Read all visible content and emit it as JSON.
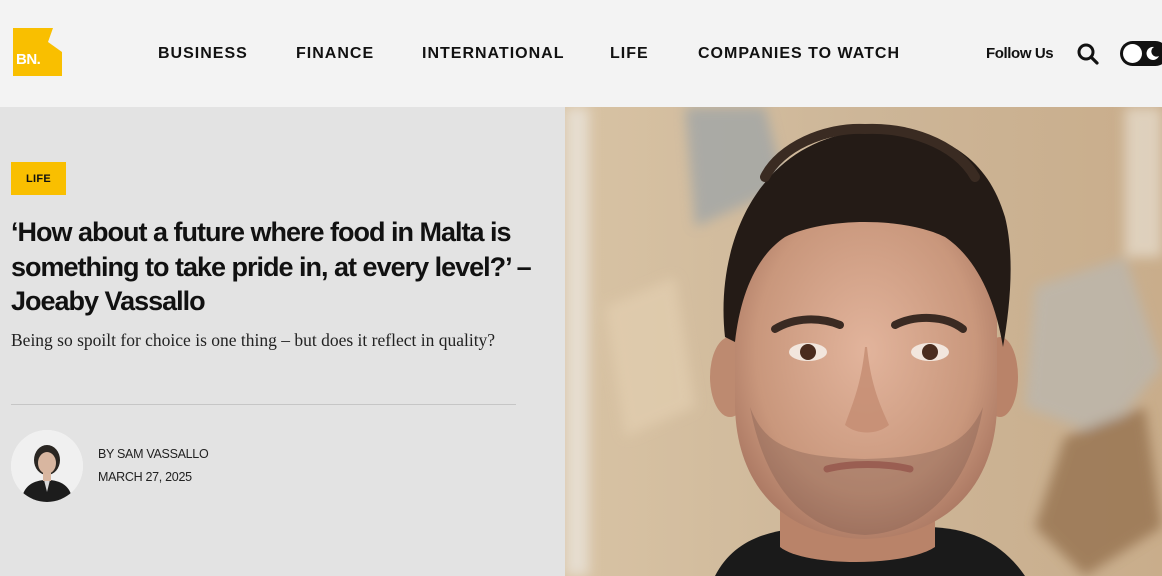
{
  "brand": {
    "logo_text": "BN.",
    "logo_color": "#f9bf00"
  },
  "nav": {
    "items": [
      {
        "label": "BUSINESS"
      },
      {
        "label": "FINANCE"
      },
      {
        "label": "INTERNATIONAL"
      },
      {
        "label": "LIFE"
      },
      {
        "label": "COMPANIES TO WATCH"
      }
    ],
    "follow_label": "Follow Us",
    "search_icon": "search-icon",
    "theme_toggle_icon": "moon-icon"
  },
  "article": {
    "category": "LIFE",
    "headline": "‘How about a future where food in Malta is something to take pride in, at every level?’ – Joeaby Vassallo",
    "standfirst": "Being so spoilt for choice is one thing – but does it reflect in quality?",
    "byline": "BY SAM VASSALLO",
    "date": "MARCH 27, 2025",
    "accent_color": "#f9bf00"
  }
}
